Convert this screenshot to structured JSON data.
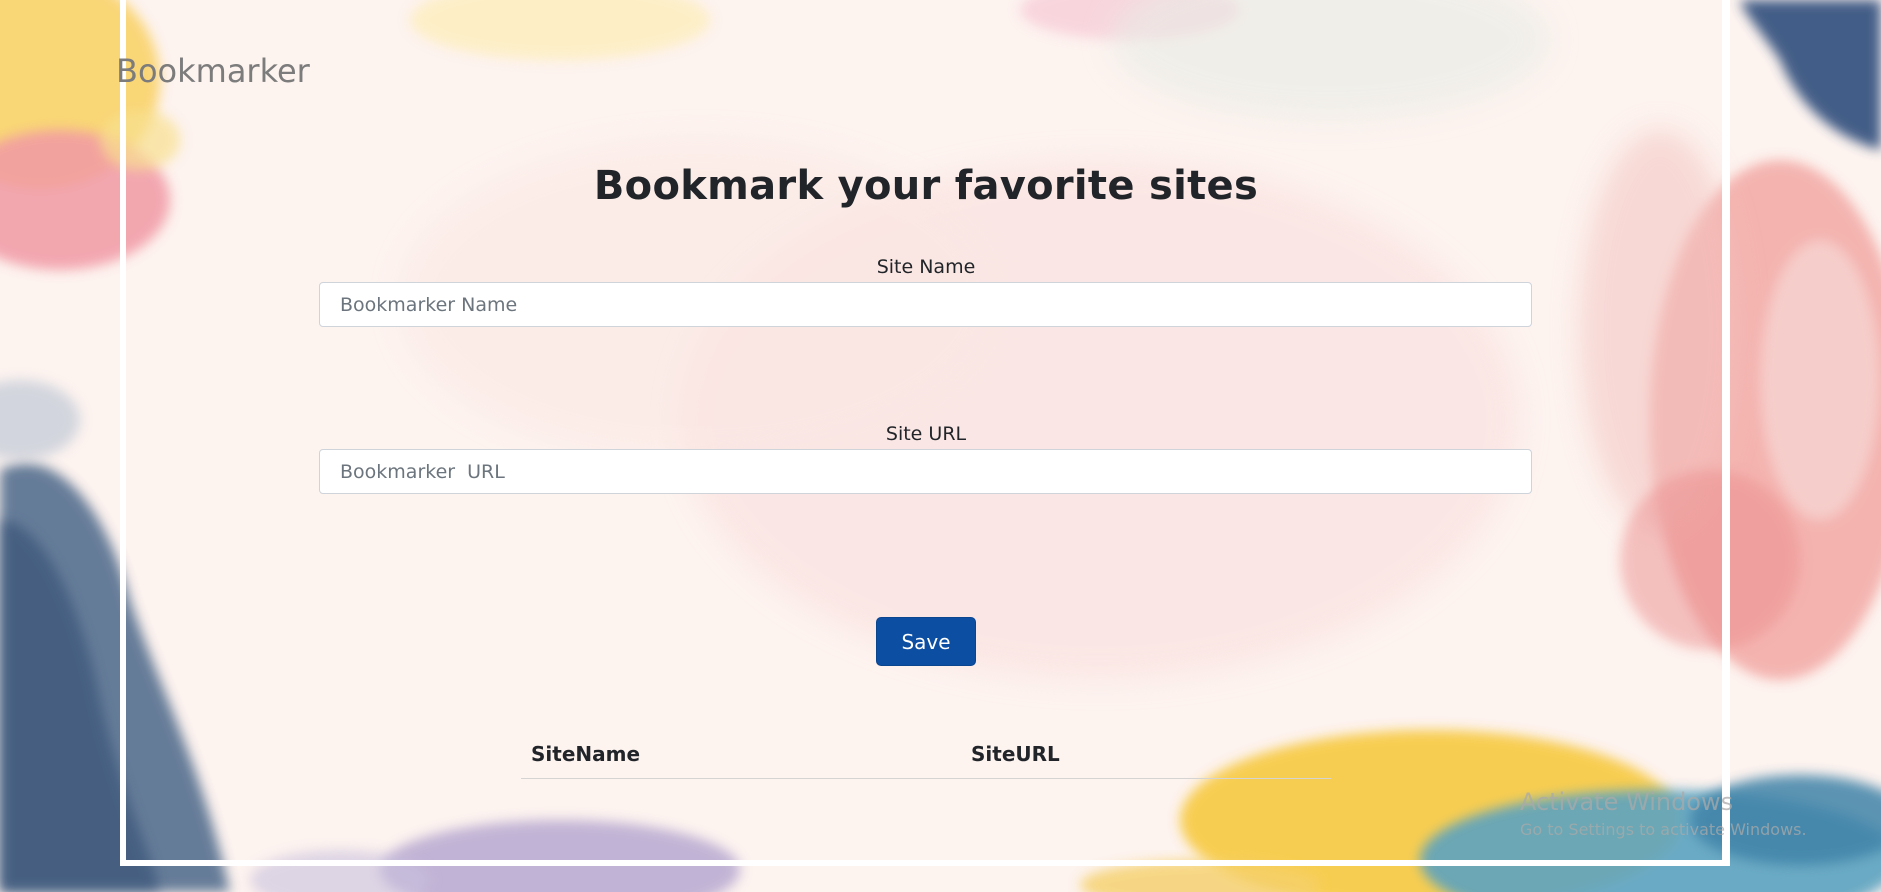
{
  "brand": {
    "name": "Bookmarker"
  },
  "main": {
    "heading": "Bookmark your favorite sites",
    "site_name": {
      "label": "Site Name",
      "placeholder": "Bookmarker Name",
      "value": ""
    },
    "site_url": {
      "label": "Site URL",
      "placeholder": "Bookmarker  URL",
      "value": ""
    },
    "save_label": "Save"
  },
  "table": {
    "columns": [
      "SiteName",
      "SiteURL"
    ],
    "rows": []
  },
  "watermark": {
    "line1": "Activate Windows",
    "line2": "Go to Settings to activate Windows."
  },
  "colors": {
    "background": "#fdf3ef",
    "primary_button": "#0b4ea2",
    "heading_text": "#212529",
    "brand_text": "#7c7c7c"
  },
  "icons": {
    "background": "watercolor-background"
  }
}
